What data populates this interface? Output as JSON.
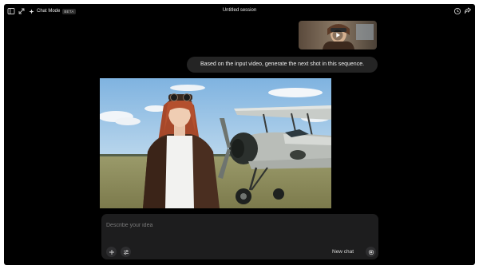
{
  "header": {
    "mode_label": "Chat Mode",
    "mode_badge": "BETA",
    "title": "Untitled session"
  },
  "icons": {
    "sidebar": "sidebar-toggle-icon",
    "expand": "expand-icon",
    "sparkle": "sparkle-icon",
    "history": "history-icon",
    "share": "share-icon",
    "play": "play-icon",
    "add": "plus-icon",
    "settings": "sliders-icon",
    "record": "record-icon"
  },
  "messages": [
    {
      "role": "user",
      "type": "video-thumbnail"
    },
    {
      "role": "user",
      "type": "text",
      "text": "Based on the input video, generate the next shot in this sequence."
    },
    {
      "role": "assistant",
      "type": "image"
    }
  ],
  "composer": {
    "placeholder": "Describe your idea",
    "new_chat_label": "New chat"
  },
  "colors": {
    "background": "#000000",
    "bubble": "#242424",
    "composer": "#1d1d1e",
    "text": "#ececec"
  }
}
